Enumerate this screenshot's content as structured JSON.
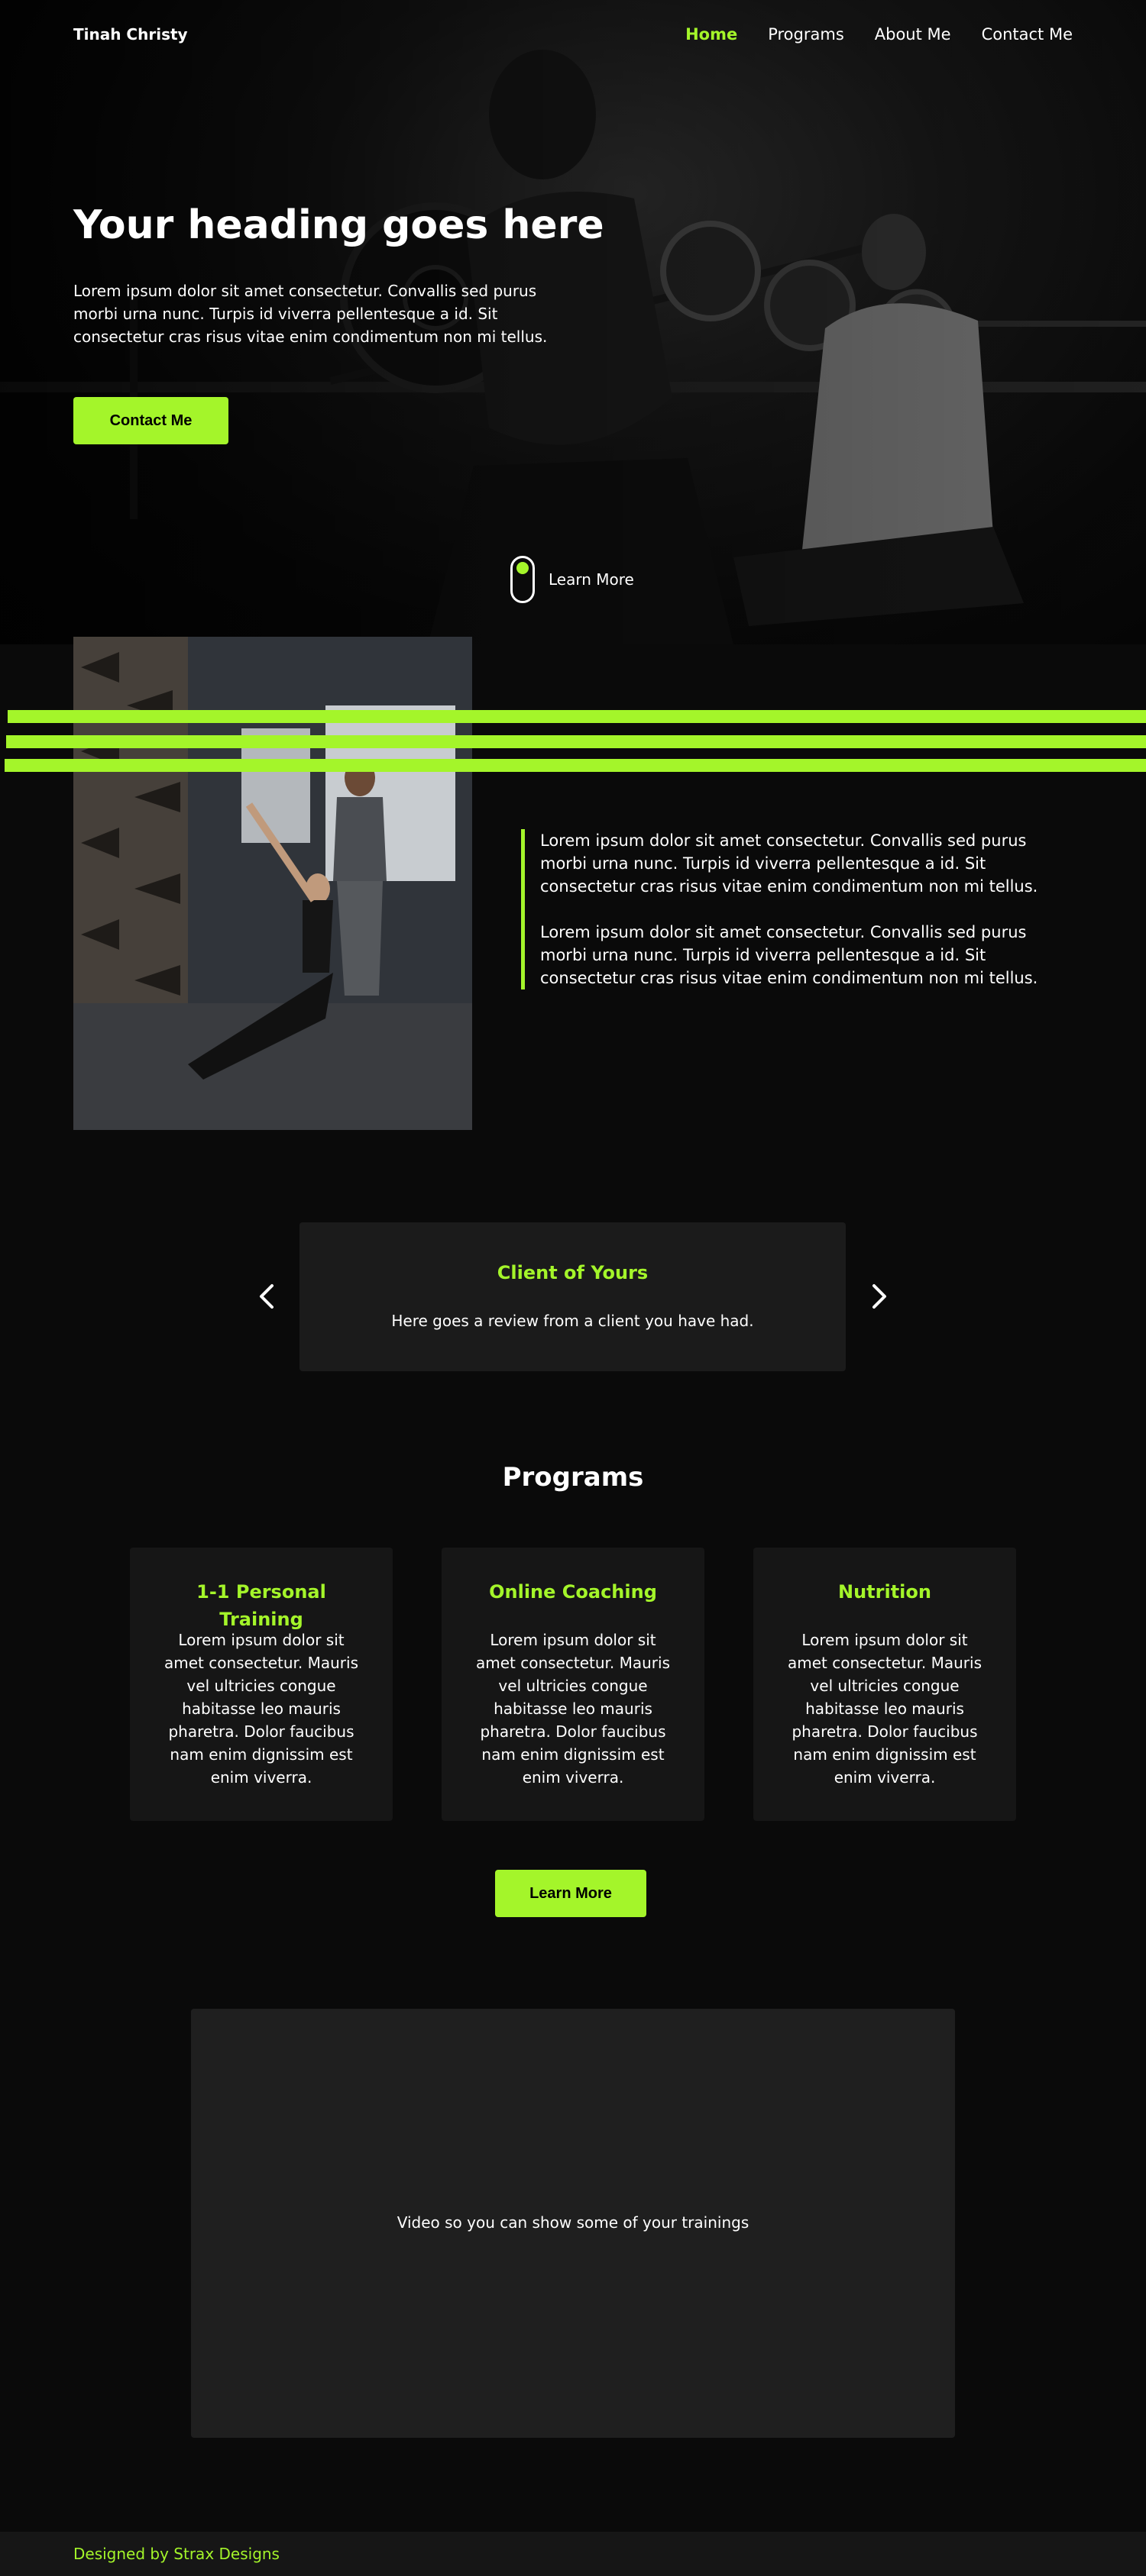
{
  "nav": {
    "brand": "Tinah Christy",
    "links": [
      "Home",
      "Programs",
      "About Me",
      "Contact Me"
    ],
    "active": "Home"
  },
  "hero": {
    "title": "Your heading goes here",
    "text": "Lorem ipsum dolor sit amet consectetur. Convallis sed purus morbi urna nunc. Turpis id viverra pellentesque a id. Sit consectetur cras risus vitae enim condimentum non mi tellus.",
    "button": "Contact Me",
    "scroll_hint": "Learn More"
  },
  "about": {
    "paragraphs": [
      "Lorem ipsum dolor sit amet consectetur. Convallis sed purus morbi urna nunc. Turpis id viverra pellentesque a id. Sit consectetur cras risus vitae enim condimentum non mi tellus.",
      "Lorem ipsum dolor sit amet consectetur. Convallis sed purus morbi urna nunc. Turpis id viverra pellentesque a id. Sit consectetur cras risus vitae enim condimentum non mi tellus."
    ]
  },
  "testimonial": {
    "name": "Client of Yours",
    "text": "Here goes a review from a client you have had.",
    "prev_icon": "chevron-left-icon",
    "next_icon": "chevron-right-icon"
  },
  "programs": {
    "title": "Programs",
    "cards": [
      {
        "title": "1-1 Personal Training",
        "text": "Lorem ipsum dolor sit amet consectetur. Mauris vel ultricies congue habitasse leo mauris pharetra. Dolor faucibus nam enim dignissim est enim viverra."
      },
      {
        "title": "Online Coaching",
        "text": "Lorem ipsum dolor sit amet consectetur. Mauris vel ultricies congue habitasse leo mauris pharetra. Dolor faucibus nam enim dignissim est enim viverra."
      },
      {
        "title": "Nutrition",
        "text": "Lorem ipsum dolor sit amet consectetur. Mauris vel ultricies congue habitasse leo mauris pharetra. Dolor faucibus nam enim dignissim est enim viverra."
      }
    ],
    "button": "Learn More"
  },
  "video": {
    "caption": "Video so you can show some of your trainings"
  },
  "footer": {
    "text": "Designed by Strax Designs"
  },
  "colors": {
    "accent": "#a4f52a",
    "background": "#0a0a0a",
    "card": "#161616",
    "video": "#1f1f1f"
  }
}
